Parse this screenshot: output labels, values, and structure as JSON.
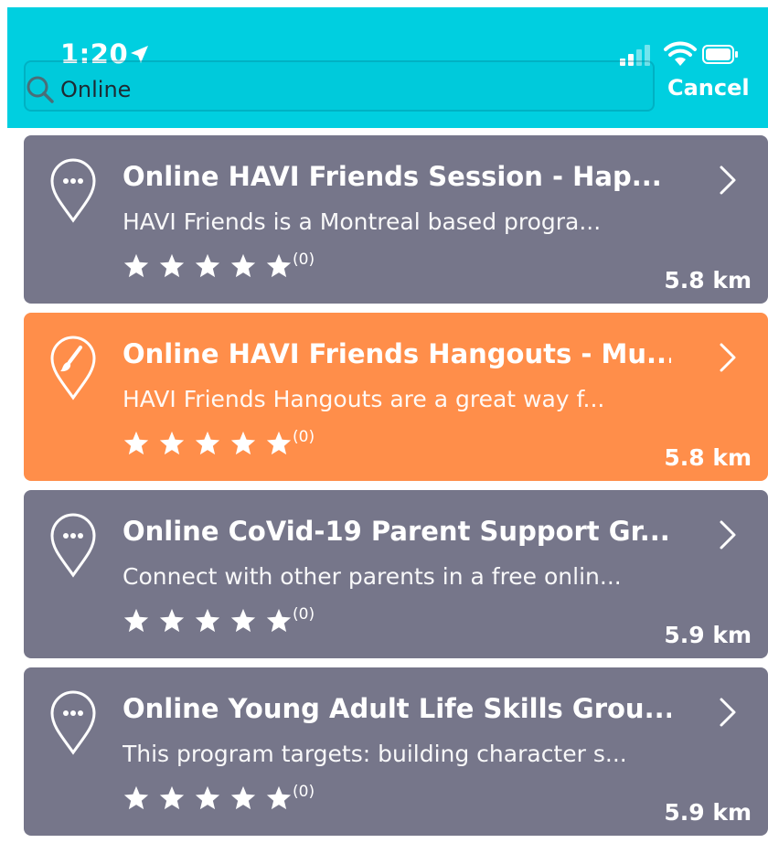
{
  "status_bar": {
    "time": "1:20"
  },
  "search": {
    "value": "Online",
    "cancel_label": "Cancel"
  },
  "colors": {
    "header": "#00cfe0",
    "card_default": "#76768a",
    "card_highlight": "#ff8e4a"
  },
  "results": [
    {
      "title": "Online HAVI Friends Session - Hap...",
      "description": "HAVI Friends is a Montreal based progra...",
      "rating_count": "(0)",
      "distance": "5.8 km",
      "icon": "more-pin-icon"
    },
    {
      "title": "Online HAVI Friends Hangouts - Mu...",
      "description": "HAVI Friends Hangouts are a great way f...",
      "rating_count": "(0)",
      "distance": "5.8 km",
      "icon": "paintbrush-pin-icon"
    },
    {
      "title": "Online CoVid-19 Parent Support Gr...",
      "description": "Connect with other parents in a free onlin...",
      "rating_count": "(0)",
      "distance": "5.9 km",
      "icon": "more-pin-icon"
    },
    {
      "title": "Online Young Adult Life Skills Grou...",
      "description": "This program targets: building character s...",
      "rating_count": "(0)",
      "distance": "5.9 km",
      "icon": "more-pin-icon"
    }
  ]
}
